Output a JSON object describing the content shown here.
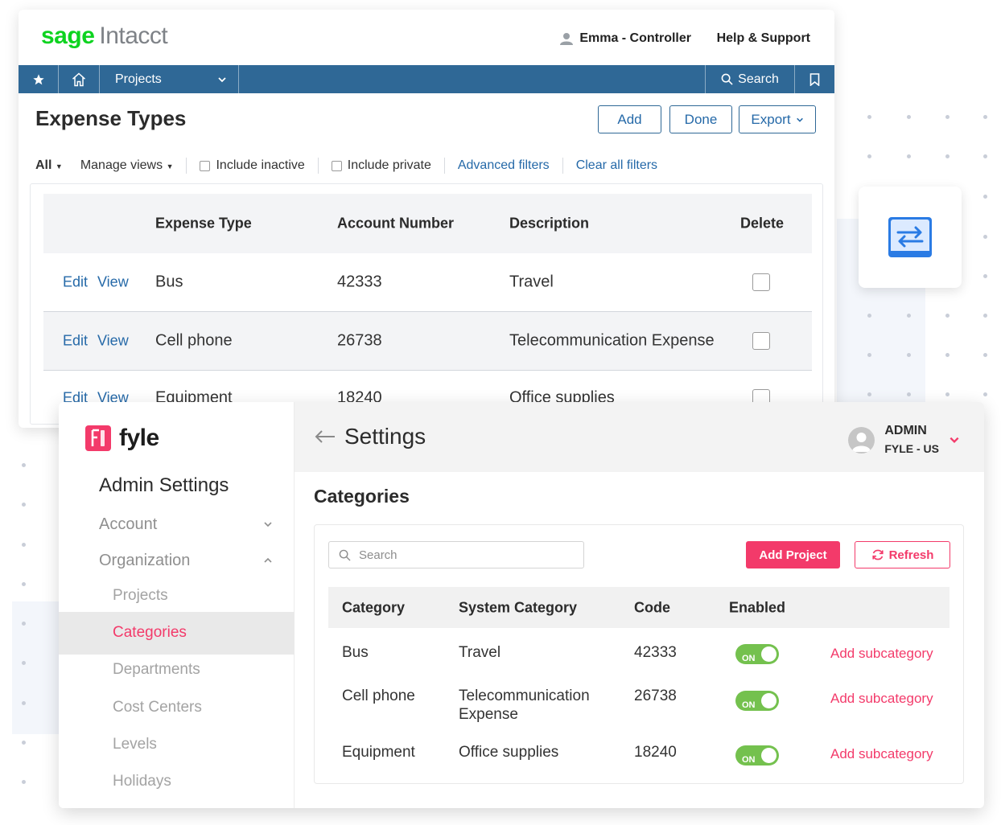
{
  "sage": {
    "logo_brand": "sage",
    "logo_product": "Intacct",
    "user_label": "Emma - Controller",
    "help_label": "Help & Support",
    "nav": {
      "module": "Projects",
      "search": "Search"
    },
    "page_title": "Expense Types",
    "buttons": {
      "add": "Add",
      "done": "Done",
      "export": "Export"
    },
    "filters": {
      "all": "All",
      "manage_views": "Manage views",
      "include_inactive": "Include inactive",
      "include_private": "Include private",
      "advanced": "Advanced filters",
      "clear": "Clear all filters"
    },
    "table": {
      "headers": [
        "Expense Type",
        "Account Number",
        "Description",
        "Delete"
      ],
      "edit_label": "Edit",
      "view_label": "View",
      "rows": [
        {
          "type": "Bus",
          "account": "42333",
          "description": "Travel"
        },
        {
          "type": "Cell phone",
          "account": "26738",
          "description": "Telecommunication Expense"
        },
        {
          "type": "Equipment",
          "account": "18240",
          "description": "Office supplies"
        }
      ]
    },
    "colors": {
      "brand": "#0ed320",
      "nav": "#2f6896",
      "link": "#2569a8"
    }
  },
  "fyle": {
    "logo_text": "fyle",
    "header_title": "Settings",
    "profile": {
      "role": "ADMIN",
      "org": "FYLE - US"
    },
    "sidebar": {
      "title": "Admin Settings",
      "sections": {
        "account": "Account",
        "organization": "Organization"
      },
      "items": [
        "Projects",
        "Categories",
        "Departments",
        "Cost Centers",
        "Levels",
        "Holidays"
      ],
      "active": "Categories"
    },
    "page_title": "Categories",
    "search_placeholder": "Search",
    "buttons": {
      "add_project": "Add Project",
      "refresh": "Refresh"
    },
    "table": {
      "headers": [
        "Category",
        "System Category",
        "Code",
        "Enabled"
      ],
      "toggle_label": "ON",
      "action_label": "Add subcategory",
      "rows": [
        {
          "category": "Bus",
          "system": "Travel",
          "system_l2": "",
          "code": "42333"
        },
        {
          "category": "Cell phone",
          "system": "Telecommunication",
          "system_l2": "Expense",
          "code": "26738"
        },
        {
          "category": "Equipment",
          "system": "Office supplies",
          "system_l2": "",
          "code": "18240"
        }
      ]
    },
    "colors": {
      "accent": "#f33a6a",
      "toggle_on": "#74c14e"
    }
  }
}
